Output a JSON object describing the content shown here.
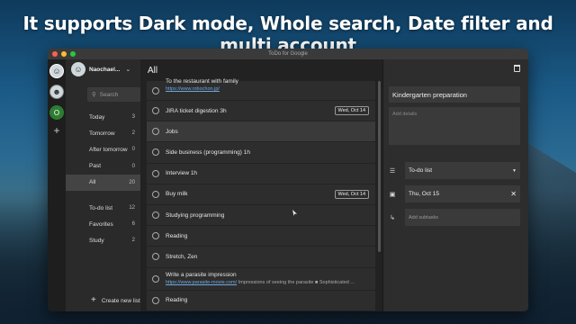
{
  "headline": "It supports Dark mode, Whole search, Date filter and multi account",
  "window": {
    "title": "ToDo for Google"
  },
  "rail": {
    "avatars": [
      "avatar-1",
      "avatar-2",
      "O"
    ],
    "add": "+"
  },
  "account": {
    "name": "Naochael...",
    "chevron": "⌄"
  },
  "search": {
    "placeholder": "Search"
  },
  "nav": [
    {
      "label": "Today",
      "count": "3"
    },
    {
      "label": "Tomorrow",
      "count": "2"
    },
    {
      "label": "After tomorrow",
      "count": "0"
    },
    {
      "label": "Past",
      "count": "0"
    },
    {
      "label": "All",
      "count": "20",
      "active": true
    },
    {
      "label": "To-do list",
      "count": "12"
    },
    {
      "label": "Favorites",
      "count": "6"
    },
    {
      "label": "Study",
      "count": "2"
    }
  ],
  "new_list": "Create new list",
  "main": {
    "title": "All",
    "tasks": [
      {
        "text": "To the restaurant with family",
        "link": "https://www.robochon.jp/"
      },
      {
        "text": "JIRA ticket digestion 3h",
        "badge": "Wed, Oct 14"
      },
      {
        "text": "Jobs",
        "highlight": true
      },
      {
        "text": "Side business (programming) 1h"
      },
      {
        "text": "Interview 1h"
      },
      {
        "text": "Buy milk",
        "badge": "Wed, Oct 14"
      },
      {
        "text": "Studying programming"
      },
      {
        "text": "Reading"
      },
      {
        "text": "Stretch, Zen"
      },
      {
        "text": "Write a parasite impression",
        "link": "https://www.parasite-movie.com/",
        "note": "Impressions of seeing the parasite ■ Sophisticated ..."
      },
      {
        "text": "Reading"
      }
    ]
  },
  "detail": {
    "title": "Kindergarten preparation",
    "details_placeholder": "Add details",
    "list": "To-do list",
    "date": "Thu, Oct 15",
    "subtasks_placeholder": "Add subtasks"
  },
  "colors": {
    "accent_green": "#2e7d32",
    "link": "#6fa8dc",
    "panel": "#2d2d2d"
  }
}
